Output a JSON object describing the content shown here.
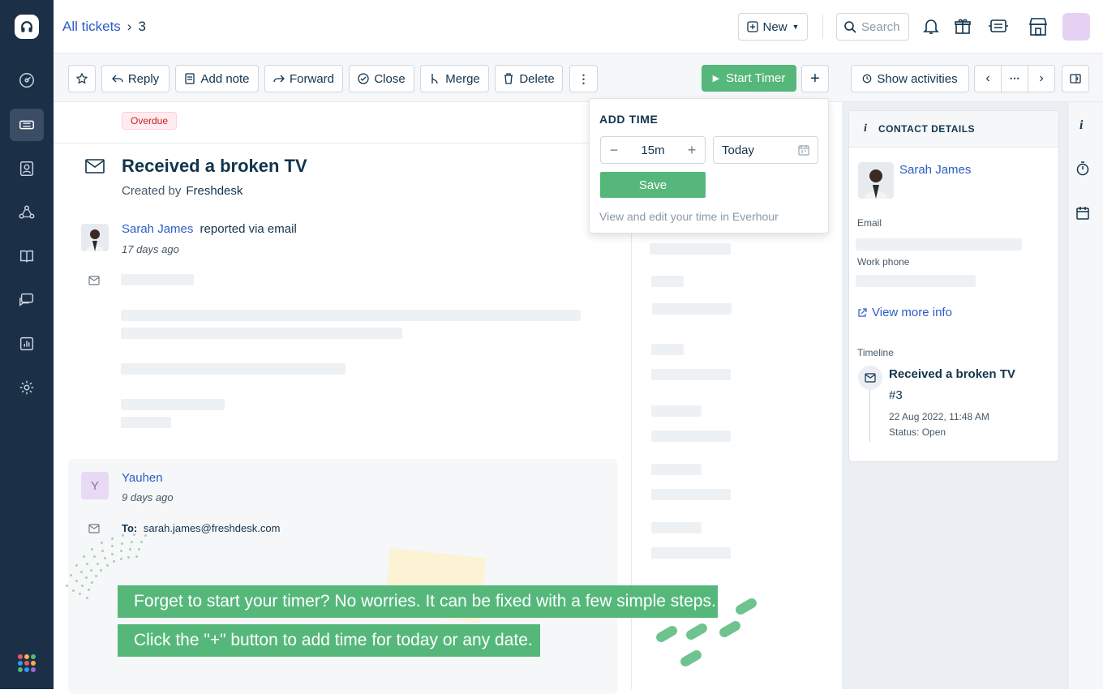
{
  "topbar": {
    "breadcrumb_link": "All tickets",
    "ticket_number": "3",
    "new_label": "New",
    "search_placeholder": "Search"
  },
  "toolbar": {
    "reply": "Reply",
    "add_note": "Add note",
    "forward": "Forward",
    "close": "Close",
    "merge": "Merge",
    "delete": "Delete",
    "start_timer": "Start Timer",
    "show_activities": "Show activities"
  },
  "ticket": {
    "badge": "Overdue",
    "title": "Received a broken TV",
    "created_by_label": "Created by",
    "created_by": "Freshdesk",
    "reporter": "Sarah James",
    "reported_via": "reported via email",
    "reported_ago": "17 days ago"
  },
  "reply": {
    "avatar_letter": "Y",
    "author": "Yauhen",
    "ago": "9 days ago",
    "to_label": "To:",
    "to_value": "sarah.james@freshdesk.com"
  },
  "add_time": {
    "title": "ADD TIME",
    "duration": "15m",
    "date": "Today",
    "save": "Save",
    "note": "View and edit your time in Everhour"
  },
  "contact": {
    "heading": "CONTACT DETAILS",
    "name": "Sarah James",
    "email_label": "Email",
    "phone_label": "Work phone",
    "more_info": "View more info",
    "timeline_label": "Timeline",
    "timeline_title": "Received a broken TV",
    "timeline_number": "#3",
    "timeline_date": "22 Aug 2022, 11:48 AM",
    "timeline_status": "Status: Open"
  },
  "tutorial": {
    "line1": "Forget to start your timer? No worries.  It can be fixed with a few simple steps.",
    "line2": "Click the \"+\" button to add time for today or any date."
  },
  "colors": {
    "sidebar": "#1b2f47",
    "accent_green": "#55b87a",
    "link_blue": "#2c5cc5",
    "overdue_red": "#c82124"
  }
}
